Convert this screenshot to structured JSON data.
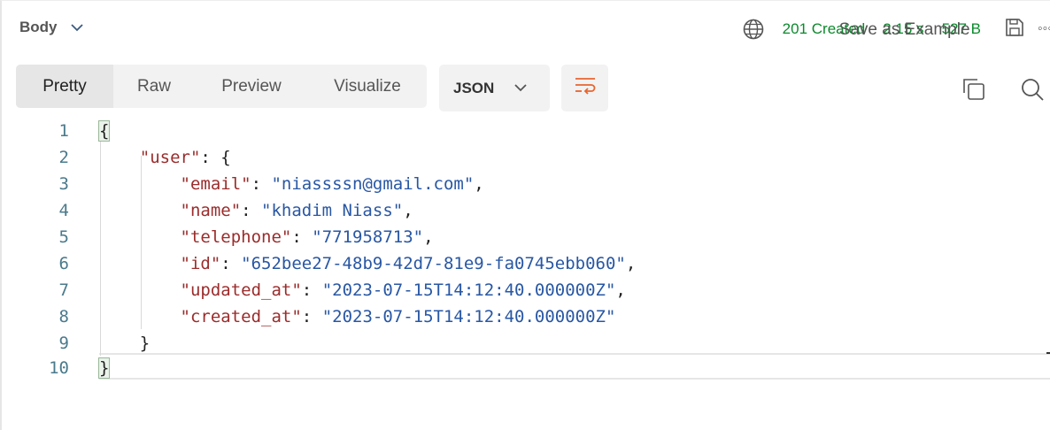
{
  "header": {
    "body_label": "Body",
    "status": "201 Created",
    "time": "2.15 s",
    "size": "527 B",
    "save_example_label": "Save as Example",
    "more_label": "◦◦◦"
  },
  "tabs": [
    {
      "label": "Pretty",
      "active": true
    },
    {
      "label": "Raw",
      "active": false
    },
    {
      "label": "Visualize",
      "active": false
    },
    {
      "label": "Preview",
      "active": false
    }
  ],
  "format": {
    "selected": "JSON"
  },
  "colors": {
    "status_green": "#0a8a2b",
    "wrap_icon": "#e8652f",
    "json_key": "#9b2c2c",
    "json_string": "#2857a4",
    "line_number": "#4a7a8c"
  },
  "icons": {
    "globe": "globe-icon",
    "save": "save-icon",
    "wrap": "wrap-lines-icon",
    "copy": "copy-icon",
    "search": "search-icon"
  },
  "code": {
    "line_numbers": [
      "1",
      "2",
      "3",
      "4",
      "5",
      "6",
      "7",
      "8",
      "9",
      "10"
    ],
    "open_brace": "{",
    "user_key": "\"user\"",
    "user_sep": ": {",
    "fields": [
      {
        "key": "\"email\"",
        "value": "\"niassssn@gmail.com\"",
        "trail": ","
      },
      {
        "key": "\"name\"",
        "value": "\"khadim Niass\"",
        "trail": ","
      },
      {
        "key": "\"telephone\"",
        "value": "\"771958713\"",
        "trail": ","
      },
      {
        "key": "\"id\"",
        "value": "\"652bee27-48b9-42d7-81e9-fa0745ebb060\"",
        "trail": ","
      },
      {
        "key": "\"updated_at\"",
        "value": "\"2023-07-15T14:12:40.000000Z\"",
        "trail": ","
      },
      {
        "key": "\"created_at\"",
        "value": "\"2023-07-15T14:12:40.000000Z\"",
        "trail": ""
      }
    ],
    "user_close": "}",
    "close_brace": "}"
  }
}
